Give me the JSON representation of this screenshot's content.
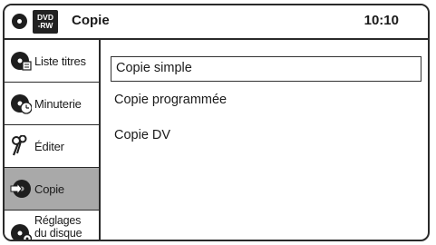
{
  "header": {
    "title": "Copie",
    "time": "10:10",
    "disc_badge": [
      "DVD",
      "-RW"
    ]
  },
  "sidebar": {
    "items": [
      {
        "label": "Liste titres",
        "icon": "title-list-icon",
        "active": false
      },
      {
        "label": "Minuterie",
        "icon": "timer-icon",
        "active": false
      },
      {
        "label": "Éditer",
        "icon": "scissors-icon",
        "active": false
      },
      {
        "label": "Copie",
        "icon": "dubbing-icon",
        "active": true
      },
      {
        "label_line1": "Réglages",
        "label_line2": "du disque",
        "icon": "disc-settings-icon",
        "active": false
      }
    ]
  },
  "menu": {
    "options": [
      {
        "label": "Copie simple",
        "selected": true
      },
      {
        "label": "Copie programmée",
        "selected": false
      },
      {
        "label": "Copie DV",
        "selected": false
      }
    ]
  }
}
